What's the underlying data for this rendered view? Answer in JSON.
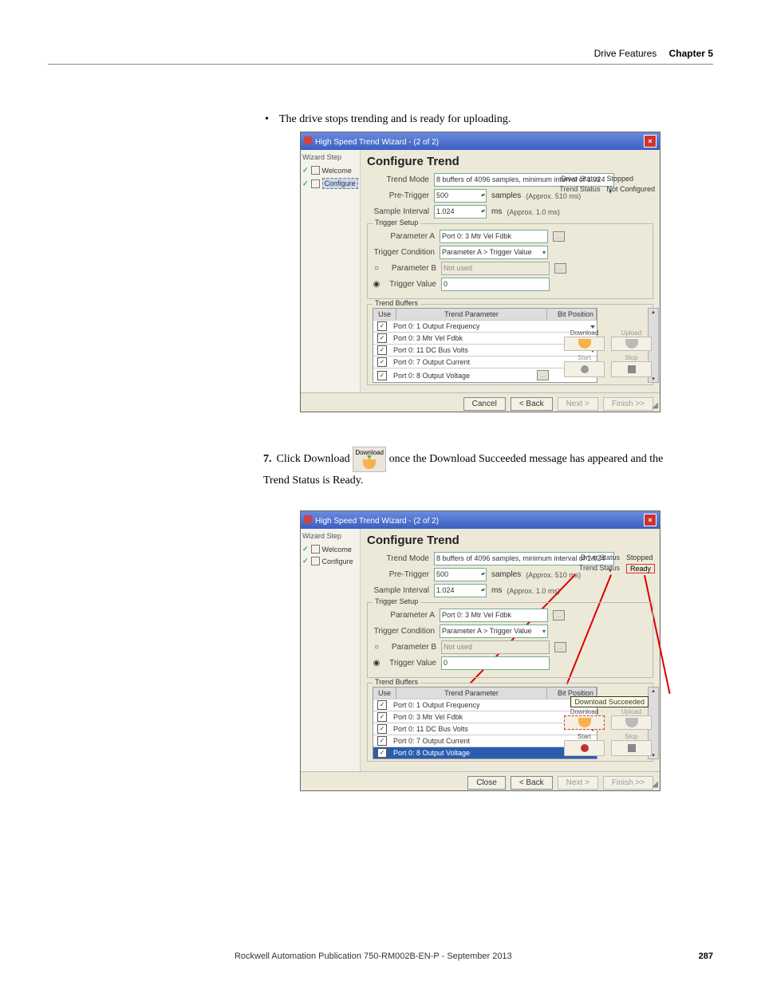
{
  "header": {
    "section": "Drive Features",
    "chapter": "Chapter 5"
  },
  "bullet": "The drive stops trending and is ready for uploading.",
  "step7": {
    "num": "7.",
    "before": "Click Download ",
    "btn_label": "Download",
    "after": " once the Download Succeeded message has appeared and the Trend Status is Ready."
  },
  "wizard": {
    "title": "High Speed Trend Wizard - (2 of 2)",
    "sidebar": {
      "heading": "Wizard Step",
      "items": [
        "Welcome",
        "Configure"
      ]
    },
    "main_title": "Configure Trend",
    "trend_mode": {
      "label": "Trend Mode",
      "value": "8 buffers of 4096 samples, minimum interval of 1.024 ms"
    },
    "pre_trigger": {
      "label": "Pre-Trigger",
      "value": "500",
      "unit": "samples",
      "approx": "(Approx. 510 ms)"
    },
    "sample_interval": {
      "label": "Sample Interval",
      "value": "1.024",
      "unit": "ms",
      "approx": "(Approx. 1.0 ms)"
    },
    "trigger_setup": {
      "legend": "Trigger Setup",
      "paramA": {
        "label": "Parameter A",
        "value": "Port 0: 3 Mtr Vel Fdbk"
      },
      "condition": {
        "label": "Trigger Condition",
        "value": "Parameter A > Trigger Value"
      },
      "paramB": {
        "label": "Parameter B",
        "value": "Not used"
      },
      "trigger_value": {
        "label": "Trigger Value",
        "value": "0"
      }
    },
    "trend_buffers": {
      "legend": "Trend Buffers",
      "cols": {
        "use": "Use",
        "tp": "Trend Parameter",
        "bp": "Bit Position"
      },
      "rows": [
        "Port 0: 1 Output Frequency",
        "Port 0: 3 Mtr Vel Fdbk",
        "Port 0: 11 DC Bus Volts",
        "Port 0: 7 Output Current",
        "Port 0: 8 Output Voltage"
      ]
    },
    "status1": {
      "drive": {
        "label": "Drive Status",
        "value": "Stopped"
      },
      "trend": {
        "label": "Trend Status",
        "value": "Not Configured"
      }
    },
    "status2": {
      "drive": {
        "label": "Drive Status",
        "value": "Stopped"
      },
      "trend": {
        "label": "Trend Status",
        "value": "Ready"
      }
    },
    "side_buttons": {
      "download": "Download",
      "upload": "Upload",
      "start": "Start",
      "stop": "Stop"
    },
    "tooltip": "Download Succeeded",
    "footer_buttons": {
      "cancel": "Cancel",
      "close": "Close",
      "back": "< Back",
      "next": "Next >",
      "finish": "Finish >>"
    }
  },
  "footer": {
    "pub": "Rockwell Automation Publication 750-RM002B-EN-P - September 2013",
    "page": "287"
  }
}
